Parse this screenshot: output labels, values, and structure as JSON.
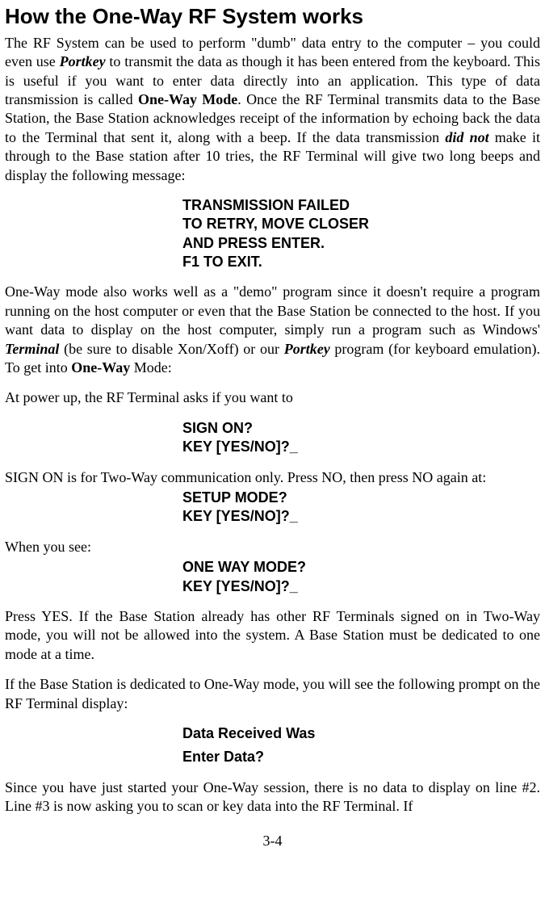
{
  "title": "How the One-Way RF System works",
  "para1_a": "The RF System can be used to perform \"dumb\" data entry to the computer – you could even use ",
  "para1_portkey": "Portkey",
  "para1_b": " to transmit the data as though it has been entered from the keyboard. This is useful if you want to enter data directly into an application. This type of data transmission is called ",
  "para1_oneway": "One-Way Mode",
  "para1_c": ".  Once the RF Terminal transmits data to the Base Station, the Base Station acknowledges receipt of the information by echoing back the data to the Terminal that sent it, along with a beep.  If the data transmission ",
  "para1_didnot": "did not",
  "para1_d": " make it through to the Base station after 10 tries, the RF Terminal will give two long beeps and display the following message:",
  "prompt1_l1": "TRANSMISSION FAILED",
  "prompt1_l2": "TO RETRY, MOVE CLOSER",
  "prompt1_l3": "AND PRESS ENTER.",
  "prompt1_l4": "F1 TO EXIT.",
  "para2_a": "One-Way mode also works well as a \"demo\" program since it doesn't require a program running on the host computer or even that the Base Station be connected to the host. If you want data to display on the host computer, simply run a program such as Windows' ",
  "para2_terminal": "Terminal",
  "para2_b": " (be sure to disable Xon/Xoff) or our ",
  "para2_portkey": "Portkey",
  "para2_c": " program (for keyboard emulation).  To get into ",
  "para2_oneway": "One-Way",
  "para2_d": " Mode:",
  "para3": "At power up, the RF Terminal asks if you want to",
  "prompt2_l1": "SIGN ON?",
  "prompt2_l2": "KEY [YES/NO]?_",
  "para4": "SIGN ON is for Two-Way communication only. Press NO, then press NO again at:",
  "prompt3_l1": "SETUP MODE?",
  "prompt3_l2": "KEY [YES/NO]?_",
  "para5": "When you see:",
  "prompt4_l1": "ONE WAY MODE?",
  "prompt4_l2": "KEY [YES/NO]?_",
  "para6": "Press YES.  If the Base Station already has other RF Terminals signed on in Two-Way mode, you will not be allowed into the system.  A Base Station must be dedicated to one mode at a time.",
  "para7": "If the Base Station is dedicated to One-Way mode, you will see the following prompt on the RF Terminal display:",
  "prompt5_l1": "Data Received Was",
  "prompt5_l2": "Enter Data?",
  "para8": "Since you have just started your One-Way session, there is no data to display on line #2.  Line #3 is now asking you to scan or key data into the RF Terminal. If",
  "page_number": "3-4"
}
